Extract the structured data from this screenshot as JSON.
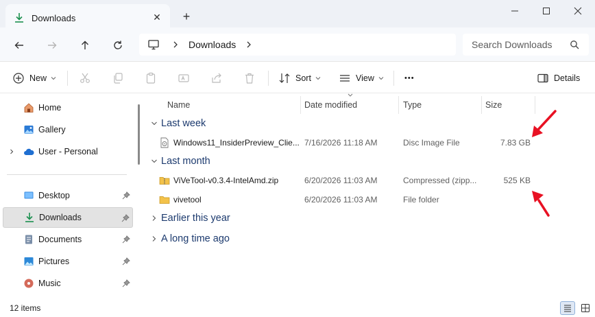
{
  "window": {
    "tab_title": "Downloads",
    "close_tab": "✕",
    "new_tab": "+"
  },
  "address": {
    "crumb": "Downloads",
    "search_placeholder": "Search Downloads"
  },
  "toolbar": {
    "new_label": "New",
    "sort_label": "Sort",
    "view_label": "View",
    "more_label": "•••",
    "details_label": "Details"
  },
  "sidebar": {
    "top_items": [
      {
        "label": "Home",
        "icon": "home-icon"
      },
      {
        "label": "Gallery",
        "icon": "gallery-icon"
      },
      {
        "label": "User - Personal",
        "icon": "cloud-icon"
      }
    ],
    "pinned_items": [
      {
        "label": "Desktop",
        "icon": "desktop-icon"
      },
      {
        "label": "Downloads",
        "icon": "download-icon",
        "selected": true
      },
      {
        "label": "Documents",
        "icon": "documents-icon"
      },
      {
        "label": "Pictures",
        "icon": "pictures-icon"
      },
      {
        "label": "Music",
        "icon": "music-icon"
      }
    ]
  },
  "columns": {
    "name": "Name",
    "date": "Date modified",
    "type": "Type",
    "size": "Size"
  },
  "groups": [
    {
      "label": "Last week",
      "expanded": true,
      "files": [
        {
          "name": "Windows11_InsiderPreview_Clie...",
          "date": "7/16/2026 11:18 AM",
          "type": "Disc Image File",
          "size": "7.83 GB",
          "icon": "disc-image-icon"
        }
      ]
    },
    {
      "label": "Last month",
      "expanded": true,
      "files": [
        {
          "name": "ViVeTool-v0.3.4-IntelAmd.zip",
          "date": "6/20/2026 11:03 AM",
          "type": "Compressed (zipp...",
          "size": "525 KB",
          "icon": "zip-folder-icon"
        },
        {
          "name": "vivetool",
          "date": "6/20/2026 11:03 AM",
          "type": "File folder",
          "size": "",
          "icon": "folder-icon"
        }
      ]
    },
    {
      "label": "Earlier this year",
      "expanded": false,
      "files": []
    },
    {
      "label": "A long time ago",
      "expanded": false,
      "files": []
    }
  ],
  "status": {
    "item_count": "12 items"
  },
  "colors": {
    "accent": "#0067c0",
    "annotation_arrow": "#e81123",
    "group_header": "#1c3a6e",
    "folder": "#f3c24a"
  }
}
